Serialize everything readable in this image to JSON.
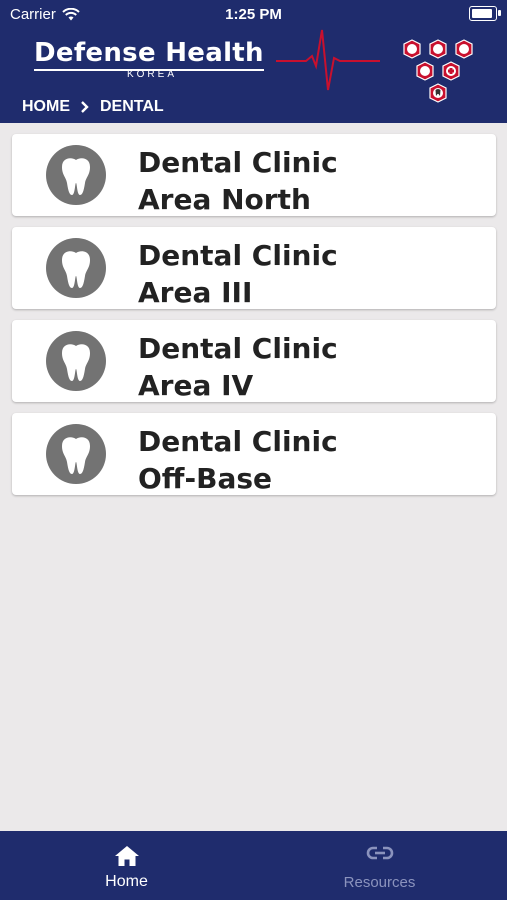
{
  "status": {
    "carrier": "Carrier",
    "time": "1:25 PM"
  },
  "header": {
    "logo_title": "Defense Health",
    "logo_sub": "KOREA",
    "breadcrumb": [
      "HOME",
      "DENTAL"
    ]
  },
  "clinics": [
    {
      "line1": "Dental Clinic",
      "line2": "Area North",
      "icon": "tooth-icon"
    },
    {
      "line1": "Dental Clinic",
      "line2": "Area III",
      "icon": "tooth-icon"
    },
    {
      "line1": "Dental Clinic",
      "line2": "Area IV",
      "icon": "tooth-icon"
    },
    {
      "line1": "Dental Clinic",
      "line2": "Off-Base",
      "icon": "tooth-icon"
    }
  ],
  "tabbar": {
    "home": {
      "label": "Home",
      "icon": "home-icon",
      "active": true
    },
    "resources": {
      "label": "Resources",
      "icon": "link-icon",
      "active": false
    }
  },
  "colors": {
    "brand": "#1f2c6d",
    "accent_red": "#c8102e",
    "background": "#ebe9ea",
    "icon_gray": "#737373"
  }
}
